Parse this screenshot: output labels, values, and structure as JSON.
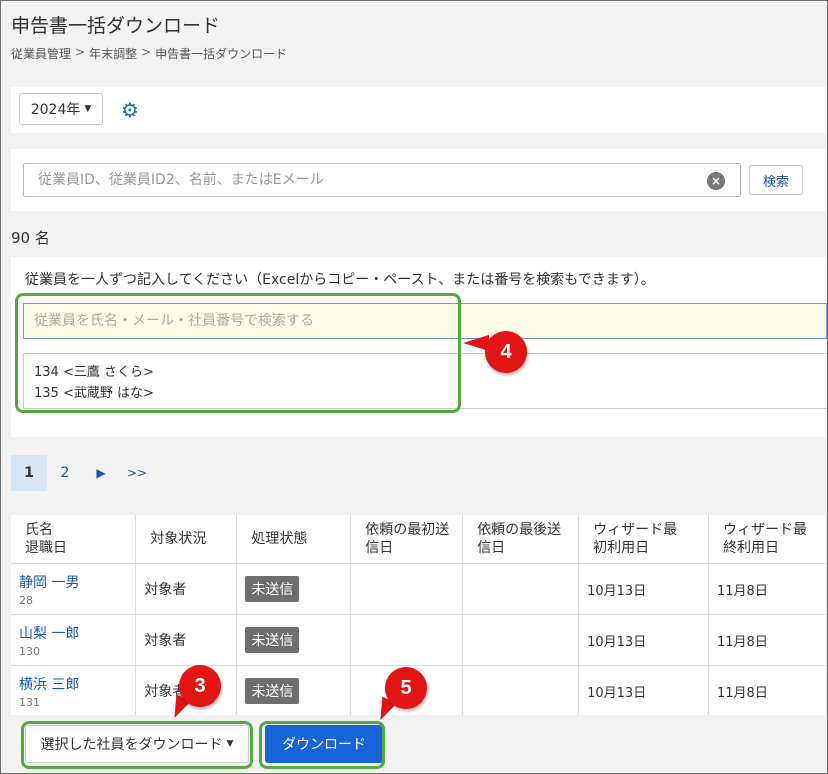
{
  "page": {
    "title": "申告書一括ダウンロード",
    "breadcrumb": [
      "従業員管理",
      "年末調整",
      "申告書一括ダウンロード"
    ],
    "breadcrumb_sep": ">"
  },
  "year_selector": {
    "value": "2024年"
  },
  "icons": {
    "settings": "gear-icon",
    "clear": "clear-icon"
  },
  "search": {
    "placeholder": "従業員ID、従業員ID2、名前、またはEメール",
    "button_label": "検索"
  },
  "count_label": "90 名",
  "entry": {
    "instruction": "従業員を一人ずつ記入してください（Excelからコピー・ペースト、または番号を検索もできます）。",
    "search_placeholder": "従業員を氏名・メール・社員番号で検索する",
    "selected": [
      "134 <三鷹 さくら>",
      "135 <武蔵野 はな>"
    ]
  },
  "pagination": {
    "pages": [
      "1",
      "2"
    ],
    "current": "1",
    "next": "▶",
    "last": ">>"
  },
  "table": {
    "headers": [
      [
        "氏名",
        "退職日"
      ],
      [
        "対象状況"
      ],
      [
        "処理状態"
      ],
      [
        "依頼の最初送",
        "信日"
      ],
      [
        "依頼の最後送",
        "信日"
      ],
      [
        "ウィザード最",
        "初利用日"
      ],
      [
        "ウィザード最",
        "終利用日"
      ]
    ],
    "rows": [
      {
        "name": "静岡 一男",
        "id": "28",
        "target": "対象者",
        "status": "未送信",
        "first_sent": "",
        "last_sent": "",
        "wizard_first": "10月13日",
        "wizard_last": "11月8日"
      },
      {
        "name": "山梨 一郎",
        "id": "130",
        "target": "対象者",
        "status": "未送信",
        "first_sent": "",
        "last_sent": "",
        "wizard_first": "10月13日",
        "wizard_last": "11月8日"
      },
      {
        "name": "横浜 三郎",
        "id": "131",
        "target": "対象者",
        "status": "未送信",
        "first_sent": "",
        "last_sent": "",
        "wizard_first": "10月13日",
        "wizard_last": "11月8日"
      }
    ]
  },
  "actions": {
    "download_selected": "選択した社員をダウンロード",
    "download": "ダウンロード"
  },
  "callouts": [
    "4",
    "3",
    "5"
  ],
  "colors": {
    "highlight": "#55aa3f",
    "callout": "#e31414",
    "primary": "#1565d8",
    "link": "#1a56b0"
  }
}
